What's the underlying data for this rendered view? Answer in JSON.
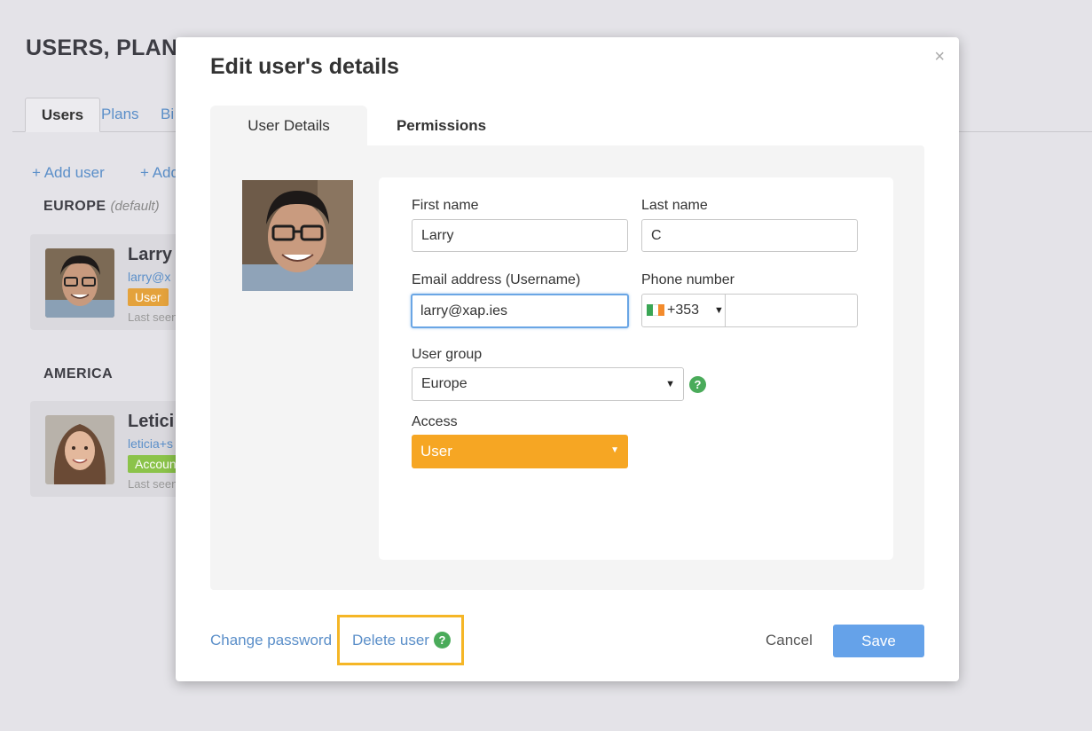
{
  "background": {
    "page_title": "USERS, PLANS",
    "tabs": [
      "Users",
      "Plans",
      "Bi"
    ],
    "add_user_link": "+ Add user",
    "add_other_link": "+ Add",
    "groups": [
      {
        "name": "EUROPE",
        "note": "(default)",
        "user": {
          "name": "Larry",
          "email": "larry@x",
          "badge": "User",
          "badge_color": "#e4a23c",
          "last_seen": "Last seen"
        }
      },
      {
        "name": "AMERICA",
        "user": {
          "name": "Letici",
          "email": "leticia+s",
          "badge": "Accoun",
          "badge_color": "#8bc34a",
          "last_seen": "Last seen"
        }
      }
    ]
  },
  "modal": {
    "title": "Edit user's details",
    "close_icon": "×",
    "tabs": [
      {
        "label": "User Details",
        "active": true
      },
      {
        "label": "Permissions",
        "active": false
      }
    ],
    "form": {
      "first_name": {
        "label": "First name",
        "value": "Larry"
      },
      "last_name": {
        "label": "Last name",
        "value": "C"
      },
      "email": {
        "label": "Email address (Username)",
        "value": "larry@xap.ies"
      },
      "phone": {
        "label": "Phone number",
        "country_code": "+353",
        "flag": "ireland-flag-icon",
        "value": ""
      },
      "user_group": {
        "label": "User group",
        "value": "Europe",
        "help": "?"
      },
      "access": {
        "label": "Access",
        "value": "User",
        "color": "#f6a623"
      }
    },
    "footer": {
      "change_password": "Change password",
      "delete_user": "Delete user",
      "delete_help": "?",
      "cancel": "Cancel",
      "save": "Save"
    }
  },
  "colors": {
    "accent": "#65a2e9",
    "link": "#5b8fc9",
    "highlight": "#f5b626",
    "help_green": "#4aab5a"
  }
}
